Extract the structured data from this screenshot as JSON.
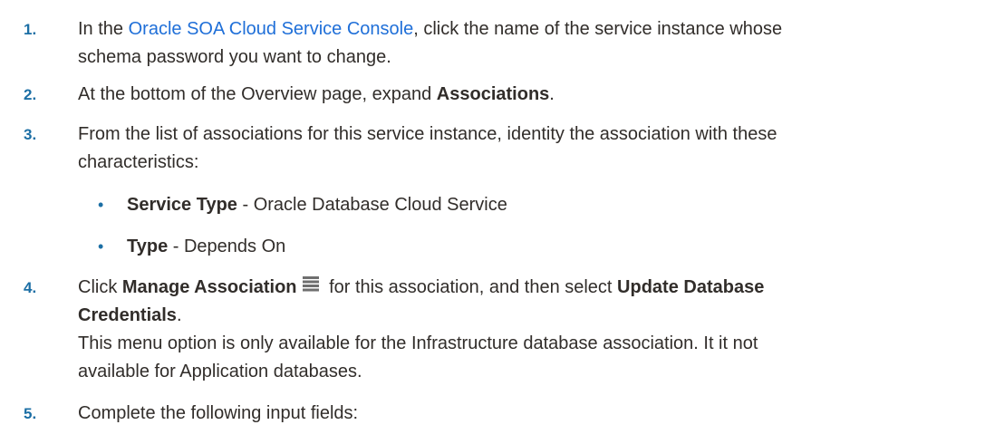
{
  "steps": [
    {
      "number": "1.",
      "prefix": "In the ",
      "link": "Oracle SOA Cloud Service Console",
      "suffix_line1": ", click the name of the service instance whose",
      "line2": "schema password you want to change."
    },
    {
      "number": "2.",
      "prefix": "At the bottom of the Overview page, expand ",
      "bold": "Associations",
      "suffix": "."
    },
    {
      "number": "3.",
      "line1": "From the list of associations for this service instance, identity the association with these",
      "line2": "characteristics:",
      "bullets": [
        {
          "label": "Service Type",
          "text": " - Oracle Database Cloud Service"
        },
        {
          "label": "Type",
          "text": " - Depends On"
        }
      ]
    },
    {
      "number": "4.",
      "prefix": "Click ",
      "bold1": "Manage Association",
      "icon": "menu-lines-icon",
      "middle": " for this association, and then select ",
      "bold2_line1": "Update Database",
      "bold2_line2": "Credentials",
      "suffix": ".",
      "note_line1": "This menu option is only available for the Infrastructure database association. It it not",
      "note_line2": "available for Application databases."
    },
    {
      "number": "5.",
      "text": "Complete the following input fields:"
    }
  ],
  "colors": {
    "link": "#1f6fd8",
    "step_number": "#1c6fa5",
    "text": "#312d2a",
    "icon": "#6f6f6f"
  }
}
